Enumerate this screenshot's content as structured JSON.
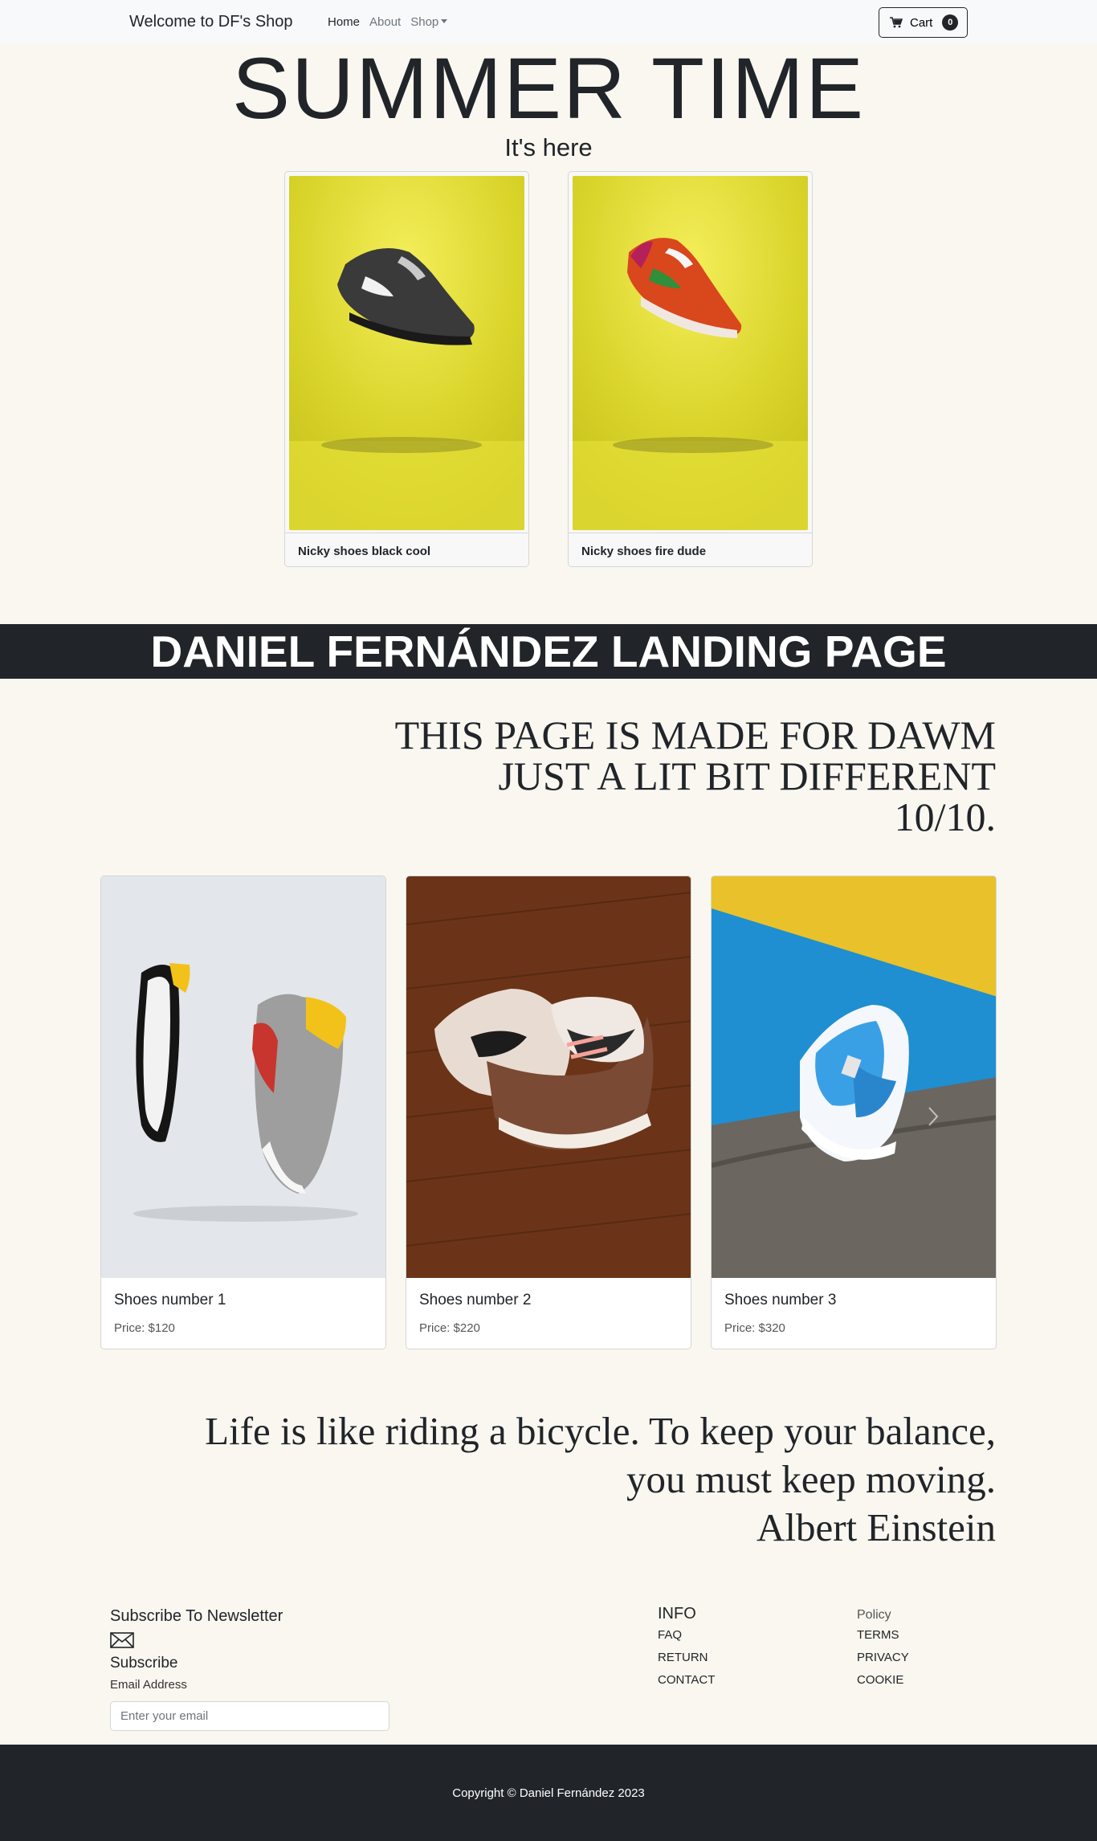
{
  "navbar": {
    "brand": "Welcome to DF's Shop",
    "links": [
      {
        "label": "Home",
        "active": true
      },
      {
        "label": "About",
        "active": false
      },
      {
        "label": "Shop",
        "active": false
      }
    ],
    "cart_label": "Cart",
    "cart_count": "0"
  },
  "hero": {
    "title": "SUMMER TIME",
    "subtitle": "It's here"
  },
  "featured": [
    {
      "caption": "Nicky shoes black cool"
    },
    {
      "caption": "Nicky shoes fire dude"
    }
  ],
  "banner": "DANIEL FERNÁNDEZ LANDING PAGE",
  "statement": [
    "THIS PAGE IS MADE FOR DAWM",
    "JUST A LIT BIT DIFFERENT",
    "10/10."
  ],
  "products": [
    {
      "name": "Shoes number 1",
      "price": "Price: $120"
    },
    {
      "name": "Shoes number 2",
      "price": "Price: $220"
    },
    {
      "name": "Shoes number 3",
      "price": "Price: $320"
    }
  ],
  "quote": [
    "Life is like riding a bicycle. To keep your balance,",
    "you must keep moving.",
    "Albert Einstein"
  ],
  "newsletter": {
    "title": "Subscribe To Newsletter",
    "subscribe": "Subscribe",
    "label": "Email Address",
    "placeholder": "Enter your email"
  },
  "info": {
    "heading": "INFO",
    "links": [
      "FAQ",
      "RETURN",
      "CONTACT"
    ]
  },
  "policy": {
    "heading": "Policy",
    "links": [
      "TERMS",
      "PRIVACY",
      "COOKIE"
    ]
  },
  "footer": {
    "copyright": "Copyright © Daniel Fernández 2023"
  },
  "colors": {
    "background": "#f9f7f0",
    "dark": "#212529",
    "navbar": "#f8f9fa"
  }
}
